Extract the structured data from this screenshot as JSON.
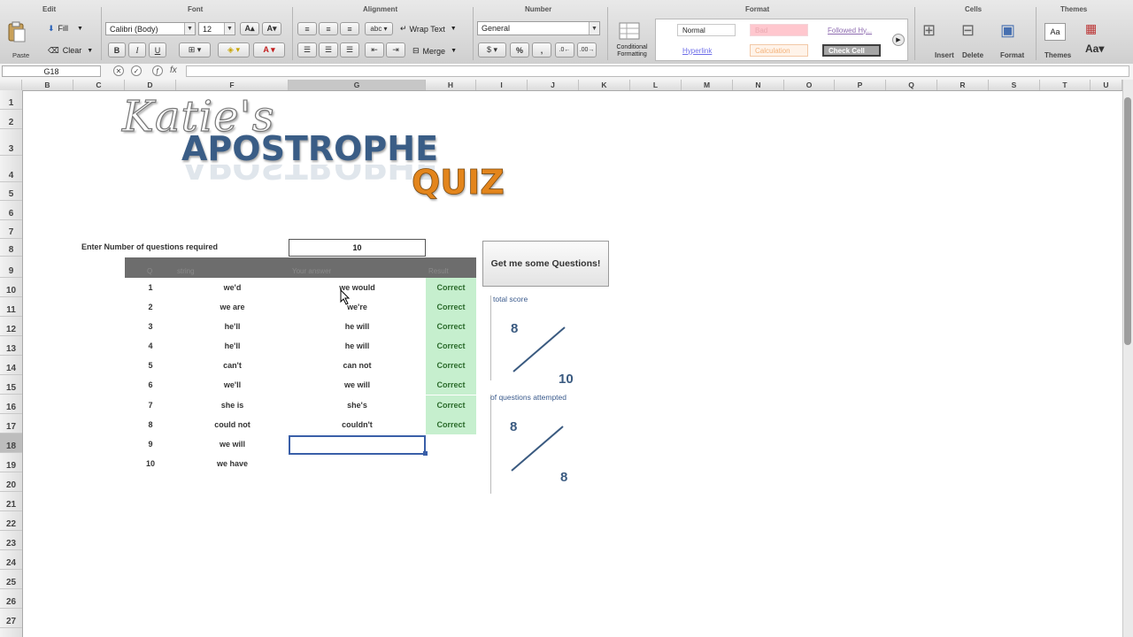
{
  "ribbon": {
    "groups": [
      "Edit",
      "Font",
      "Alignment",
      "Number",
      "Format",
      "Cells",
      "Themes"
    ],
    "paste_label": "Paste",
    "fill_label": "Fill",
    "clear_label": "Clear",
    "font_name": "Calibri (Body)",
    "font_size": "12",
    "wrap_text_label": "Wrap Text",
    "merge_label": "Merge",
    "number_format": "General",
    "conditional_formatting_label": "Conditional Formatting",
    "styles": {
      "normal": "Normal",
      "bad": "Bad",
      "followed": "Followed Hy...",
      "hyperlink": "Hyperlink",
      "calculation": "Calculation",
      "check_cell": "Check Cell"
    },
    "insert_label": "Insert",
    "delete_label": "Delete",
    "format_label": "Format",
    "themes_label": "Themes"
  },
  "formula_bar": {
    "name_box": "G18",
    "fx": "fx",
    "value": ""
  },
  "columns": [
    "B",
    "C",
    "D",
    "F",
    "G",
    "H",
    "I",
    "J",
    "K",
    "L",
    "M",
    "N",
    "O",
    "P",
    "Q",
    "R",
    "S",
    "T",
    "U"
  ],
  "rows": [
    "1",
    "2",
    "3",
    "4",
    "5",
    "6",
    "7",
    "8",
    "9",
    "10",
    "11",
    "12",
    "13",
    "14",
    "15",
    "16",
    "17",
    "18",
    "19",
    "20",
    "21",
    "22",
    "23",
    "24",
    "25",
    "26",
    "27"
  ],
  "logo": {
    "line1": "Katie's",
    "line2": "APOSTROPHE",
    "line3": "QUIZ"
  },
  "quiz": {
    "prompt": "Enter Number of questions required",
    "count": "10",
    "headers": {
      "no": "Q",
      "string": "string",
      "answer": "Your answer",
      "result": "Result"
    },
    "items": [
      {
        "no": "1",
        "string": "we'd",
        "answer": "we would",
        "result": "Correct"
      },
      {
        "no": "2",
        "string": "we are",
        "answer": "we're",
        "result": "Correct"
      },
      {
        "no": "3",
        "string": "he'll",
        "answer": "he will",
        "result": "Correct"
      },
      {
        "no": "4",
        "string": "he'll",
        "answer": "he will",
        "result": "Correct"
      },
      {
        "no": "5",
        "string": "can't",
        "answer": "can not",
        "result": "Correct"
      },
      {
        "no": "6",
        "string": "we'll",
        "answer": "we will",
        "result": "Correct"
      },
      {
        "no": "7",
        "string": "she is",
        "answer": "she's",
        "result": "Correct"
      },
      {
        "no": "8",
        "string": "could not",
        "answer": "couldn't",
        "result": "Correct"
      },
      {
        "no": "9",
        "string": "we will",
        "answer": "",
        "result": ""
      },
      {
        "no": "10",
        "string": "we have",
        "answer": "",
        "result": ""
      }
    ]
  },
  "button": {
    "label": "Get me some Questions!"
  },
  "score": {
    "total_label": "total score",
    "total_num": "8",
    "total_den": "10",
    "attempted_label": "of questions attempted",
    "attempted_num": "8",
    "attempted_den": "8"
  },
  "colors": {
    "correct_fill": "#c6efce",
    "header_bar": "#6d6d6d",
    "apostrophe_blue": "#3a5d86",
    "quiz_orange": "#e3851c"
  }
}
